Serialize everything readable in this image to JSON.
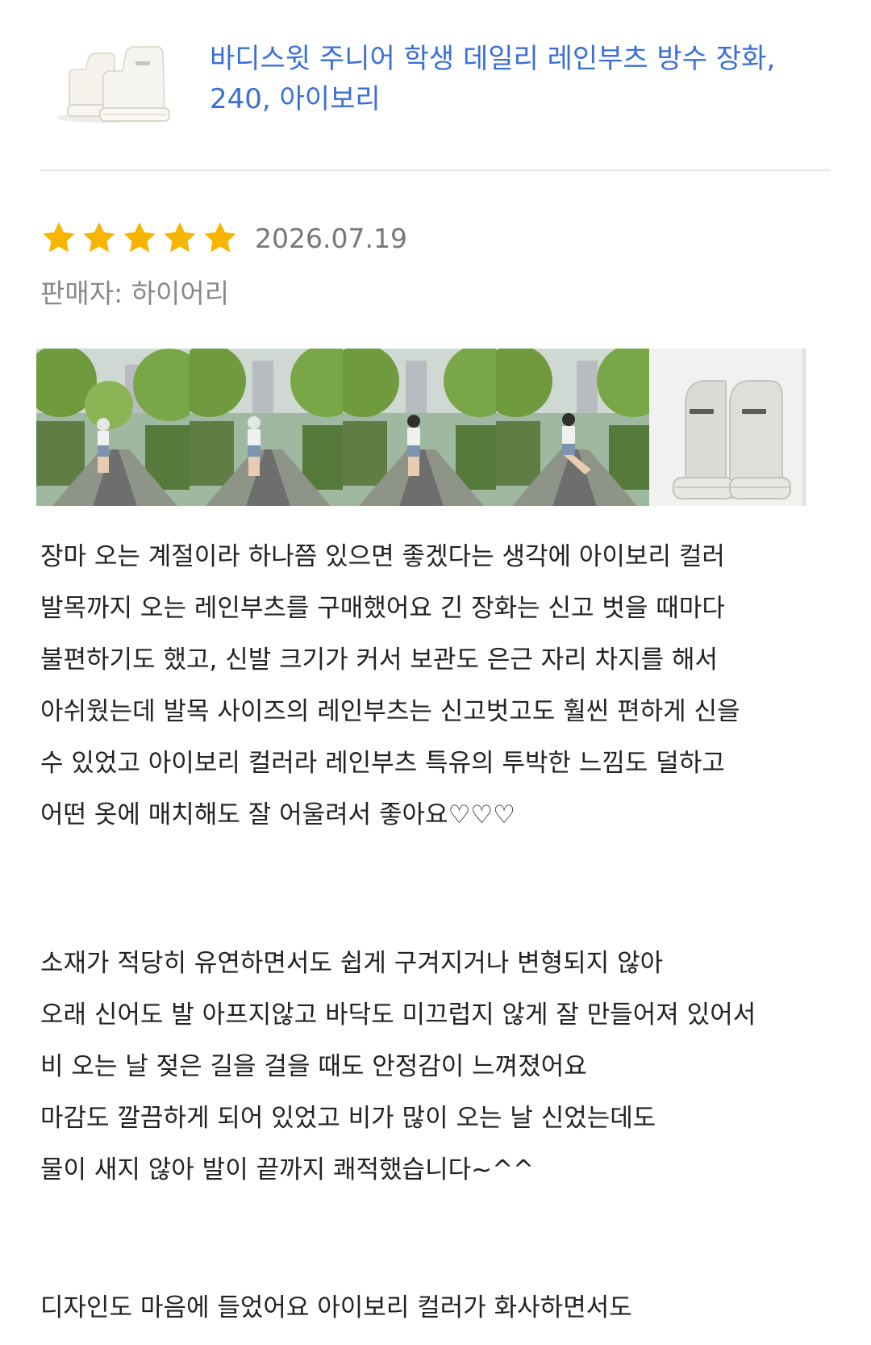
{
  "product": {
    "title": "바디스윗 주니어 학생 데일리 레인부츠 방수 장화, 240, 아이보리",
    "thumbnail_icon": "rain-boots-image"
  },
  "review": {
    "rating": 5,
    "max_rating": 5,
    "date": "2026.07.19",
    "seller": "판매자: 하이어리",
    "star_color": "#f7b500",
    "photos": [
      {
        "icon": "outdoor-photo-1"
      },
      {
        "icon": "outdoor-photo-2"
      },
      {
        "icon": "outdoor-photo-3"
      },
      {
        "icon": "outdoor-photo-4"
      },
      {
        "icon": "boots-photo"
      }
    ],
    "paragraph_1": "장마 오는 계절이라 하나쯤 있으면 좋겠다는 생각에 아이보리 컬러\n발목까지 오는 레인부츠를 구매했어요  긴 장화는 신고 벗을 때마다\n불편하기도 했고, 신발 크기가 커서 보관도 은근 자리 차지를 해서\n아쉬웠는데 발목 사이즈의 레인부츠는 신고벗고도 훨씬 편하게 신을\n수 있었고 아이보리 컬러라 레인부츠 특유의 투박한 느낌도 덜하고\n어떤 옷에 매치해도 잘 어울려서 좋아요♡♡♡",
    "paragraph_2": "소재가 적당히 유연하면서도 쉽게 구겨지거나 변형되지 않아\n오래 신어도 발 아프지않고 바닥도 미끄럽지 않게 잘 만들어져 있어서\n비 오는 날 젖은 길을 걸을 때도 안정감이 느껴졌어요\n마감도 깔끔하게 되어 있었고 비가 많이 오는 날 신었는데도\n물이 새지 않아 발이 끝까지 쾌적했습니다~^^",
    "paragraph_3": "디자인도 마음에 들었어요 아이보리 컬러가 화사하면서도"
  }
}
